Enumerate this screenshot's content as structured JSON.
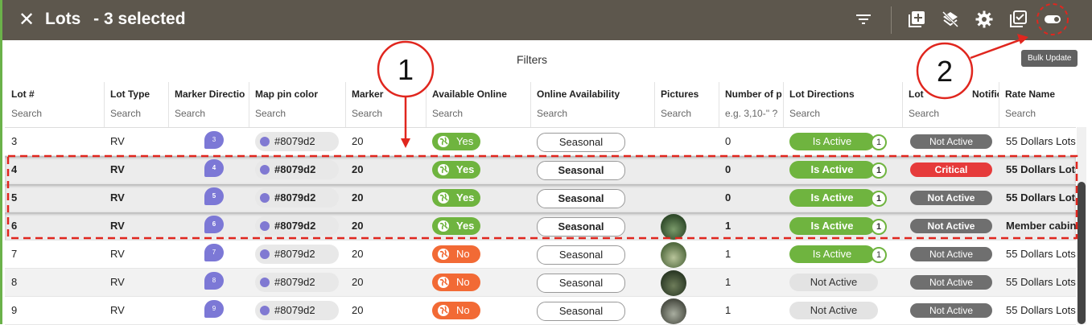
{
  "header": {
    "close_glyph": "✕",
    "title": "Lots",
    "selected_text": "- 3 selected",
    "icons": [
      "filter-icon",
      "add-box-icon",
      "layers-off-icon",
      "gear-icon",
      "select-all-checkbox-icon",
      "toggle-icon"
    ]
  },
  "filters_label": "Filters",
  "tooltip": "Bulk Update",
  "callouts": {
    "one": "1",
    "two": "2"
  },
  "columns": [
    {
      "title": "Lot #",
      "search": "Search"
    },
    {
      "title": "Lot Type",
      "search": "Search"
    },
    {
      "title": "Marker Directio",
      "search": "Search"
    },
    {
      "title": "Map pin color",
      "search": "Search"
    },
    {
      "title": "Marker",
      "search": "Search"
    },
    {
      "title": "Available Online",
      "search": "Search"
    },
    {
      "title": "Online Availability",
      "search": "Search"
    },
    {
      "title": "Pictures",
      "search": "Search"
    },
    {
      "title": "Number of p",
      "search": "e.g. 3,10-'' ?"
    },
    {
      "title": "Lot Directions",
      "search": "Search"
    },
    {
      "title": "Lot",
      "search": "Search"
    },
    {
      "title": "Rate Name",
      "search": "Search"
    }
  ],
  "extra_header_fragment": "Notificat",
  "colors": {
    "header": "#5d574d",
    "pin": "#8079d2",
    "yes": "#6fb43f",
    "no": "#f26a35",
    "critical": "#e63b3b",
    "not_active_pill": "#6f6f6f",
    "annotation": "#e0261e"
  },
  "rows": [
    {
      "lot": "3",
      "type": "RV",
      "marker": "3",
      "pin": "#8079d2",
      "markercol": "20",
      "avail": "Yes",
      "online": "Seasonal",
      "pictures": 0,
      "num": "0",
      "dir": "Is Active",
      "dir_count": "1",
      "notif": "Not Active",
      "rate": "55 Dollars Lots",
      "selected": false
    },
    {
      "lot": "4",
      "type": "RV",
      "marker": "4",
      "pin": "#8079d2",
      "markercol": "20",
      "avail": "Yes",
      "online": "Seasonal",
      "pictures": 0,
      "num": "0",
      "dir": "Is Active",
      "dir_count": "1",
      "notif": "Critical",
      "rate": "55 Dollars Lots",
      "selected": true
    },
    {
      "lot": "5",
      "type": "RV",
      "marker": "5",
      "pin": "#8079d2",
      "markercol": "20",
      "avail": "Yes",
      "online": "Seasonal",
      "pictures": 0,
      "num": "0",
      "dir": "Is Active",
      "dir_count": "1",
      "notif": "Not Active",
      "rate": "55 Dollars Lots",
      "selected": true
    },
    {
      "lot": "6",
      "type": "RV",
      "marker": "6",
      "pin": "#8079d2",
      "markercol": "20",
      "avail": "Yes",
      "online": "Seasonal",
      "pictures": 1,
      "num": "1",
      "dir": "Is Active",
      "dir_count": "1",
      "notif": "Not Active",
      "rate": "Member cabin",
      "selected": true
    },
    {
      "lot": "7",
      "type": "RV",
      "marker": "7",
      "pin": "#8079d2",
      "markercol": "20",
      "avail": "No",
      "online": "Seasonal",
      "pictures": 1,
      "num": "1",
      "dir": "Is Active",
      "dir_count": "1",
      "notif": "Not Active",
      "rate": "55 Dollars Lots",
      "selected": false
    },
    {
      "lot": "8",
      "type": "RV",
      "marker": "8",
      "pin": "#8079d2",
      "markercol": "20",
      "avail": "No",
      "online": "Seasonal",
      "pictures": 1,
      "num": "1",
      "dir": "Not Active",
      "dir_count": "",
      "notif": "Not Active",
      "rate": "55 Dollars Lots",
      "selected": false
    },
    {
      "lot": "9",
      "type": "RV",
      "marker": "9",
      "pin": "#8079d2",
      "markercol": "20",
      "avail": "No",
      "online": "Seasonal",
      "pictures": 1,
      "num": "1",
      "dir": "Not Active",
      "dir_count": "",
      "notif": "Not Active",
      "rate": "55 Dollars Lots",
      "selected": false
    }
  ]
}
